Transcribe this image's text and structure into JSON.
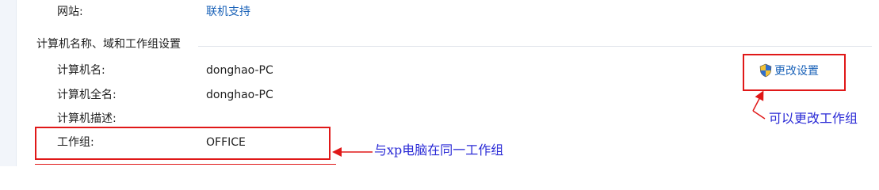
{
  "website": {
    "label": "网站:",
    "value": "联机支持"
  },
  "section": {
    "title": "计算机名称、域和工作组设置"
  },
  "fields": [
    {
      "label": "计算机名:",
      "value": "donghao-PC"
    },
    {
      "label": "计算机全名:",
      "value": "donghao-PC"
    },
    {
      "label": "计算机描述:",
      "value": ""
    },
    {
      "label": "工作组:",
      "value": "OFFICE"
    }
  ],
  "change_settings": {
    "label": "更改设置",
    "icon": "uac-shield-icon"
  },
  "annotations": {
    "change_note": "可以更改工作组",
    "workgroup_note": "与xp电脑在同一工作组"
  },
  "colors": {
    "link": "#1a62b8",
    "annotation_red": "#e01818",
    "annotation_blue": "#2a2ad6"
  }
}
